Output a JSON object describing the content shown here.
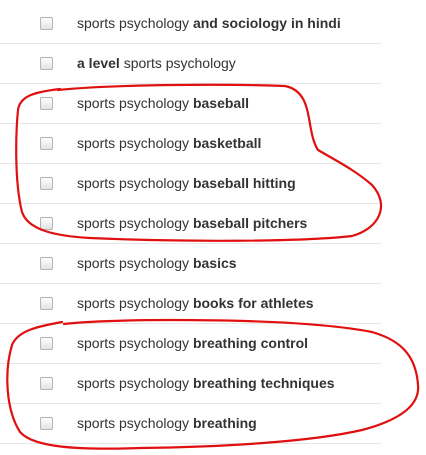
{
  "keywords": [
    {
      "plain_before": "sports psychology ",
      "bold": "and sociology in hindi",
      "plain_after": ""
    },
    {
      "plain_before": "",
      "bold": "a level",
      "plain_after": " sports psychology"
    },
    {
      "plain_before": "sports psychology ",
      "bold": "baseball",
      "plain_after": ""
    },
    {
      "plain_before": "sports psychology ",
      "bold": "basketball",
      "plain_after": ""
    },
    {
      "plain_before": "sports psychology ",
      "bold": "baseball hitting",
      "plain_after": ""
    },
    {
      "plain_before": "sports psychology ",
      "bold": "baseball pitchers",
      "plain_after": ""
    },
    {
      "plain_before": "sports psychology ",
      "bold": "basics",
      "plain_after": ""
    },
    {
      "plain_before": "sports psychology ",
      "bold": "books for athletes",
      "plain_after": ""
    },
    {
      "plain_before": "sports psychology ",
      "bold": "breathing control",
      "plain_after": ""
    },
    {
      "plain_before": "sports psychology ",
      "bold": "breathing techniques",
      "plain_after": ""
    },
    {
      "plain_before": "sports psychology ",
      "bold": "breathing",
      "plain_after": ""
    }
  ],
  "annotation_color": "#e01010"
}
